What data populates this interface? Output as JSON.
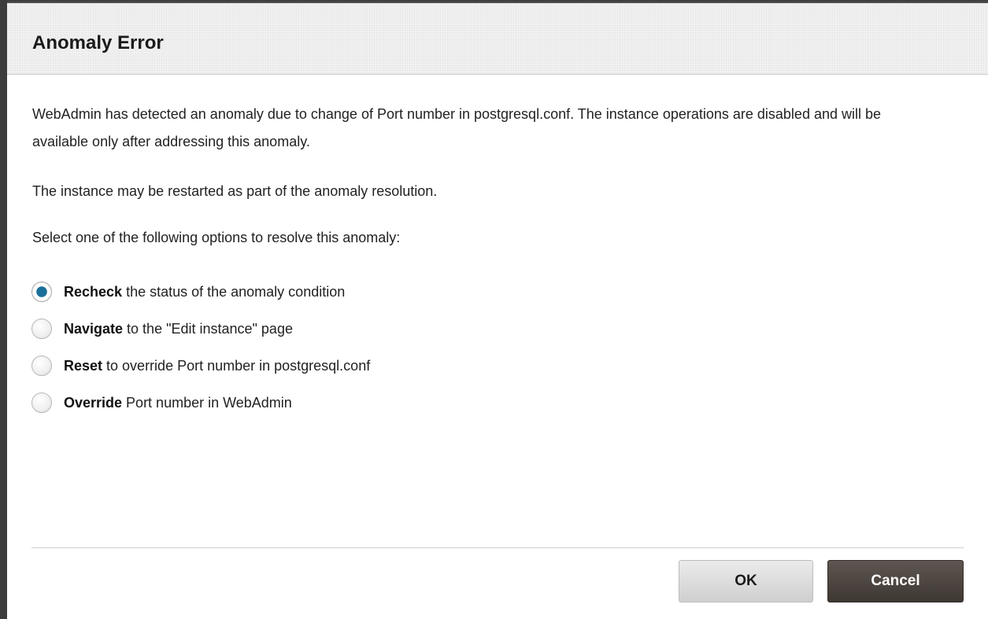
{
  "dialog": {
    "title": "Anomaly Error",
    "message": "WebAdmin has detected an anomaly due to change of Port number in postgresql.conf. The instance operations are disabled and will be available only after addressing this anomaly.",
    "restart_note": "The instance may be restarted as part of the anomaly resolution.",
    "instruction": "Select one of the following options to resolve this anomaly:",
    "selected_option": "recheck",
    "options": [
      {
        "id": "recheck",
        "bold": "Recheck",
        "text": " the status of the anomaly condition"
      },
      {
        "id": "navigate",
        "bold": "Navigate",
        "text": " to the \"Edit instance\" page"
      },
      {
        "id": "reset",
        "bold": "Reset",
        "text": " to override Port number in postgresql.conf"
      },
      {
        "id": "override",
        "bold": "Override",
        "text": " Port number in WebAdmin"
      }
    ],
    "ok_label": "OK",
    "cancel_label": "Cancel"
  },
  "colors": {
    "radio_selected": "#1a6f9a",
    "cancel_button": "#4a423c",
    "ok_button": "#dcdcdc"
  }
}
